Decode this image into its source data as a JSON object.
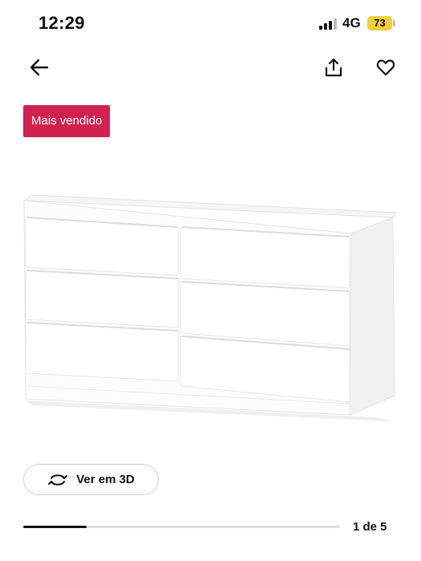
{
  "status_bar": {
    "time": "12:29",
    "network": "4G",
    "battery": "73",
    "battery_color": "#f2cf3b"
  },
  "nav": {
    "back_icon": "arrow-left-icon",
    "share_icon": "share-icon",
    "favorite_icon": "heart-icon"
  },
  "badge": {
    "label": "Mais vendido",
    "color": "#d1224f"
  },
  "product": {
    "image": "white-six-drawer-dresser"
  },
  "view_3d": {
    "label": "Ver em 3D",
    "icon": "rotate-icon"
  },
  "gallery": {
    "counter": "1 de 5",
    "current": 1,
    "total": 5
  }
}
